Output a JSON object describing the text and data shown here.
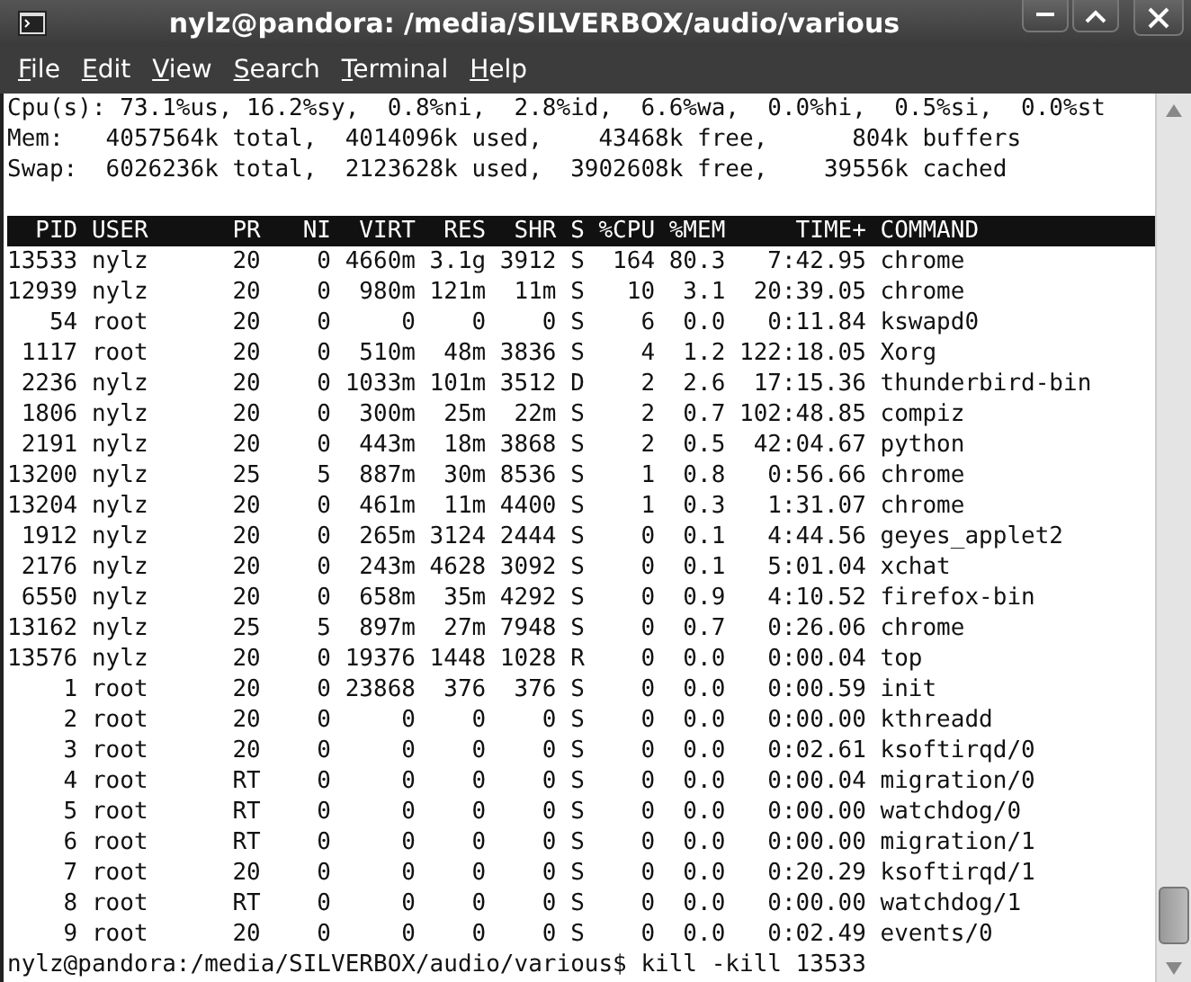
{
  "window": {
    "title": "nylz@pandora: /media/SILVERBOX/audio/various"
  },
  "menu": [
    "File",
    "Edit",
    "View",
    "Search",
    "Terminal",
    "Help"
  ],
  "terminal": {
    "summary": [
      "Cpu(s): 73.1%us, 16.2%sy,  0.8%ni,  2.8%id,  6.6%wa,  0.0%hi,  0.5%si,  0.0%st",
      "Mem:   4057564k total,  4014096k used,    43468k free,      804k buffers",
      "Swap:  6026236k total,  2123628k used,  3902608k free,    39556k cached"
    ],
    "columns": [
      "PID",
      "USER",
      "PR",
      "NI",
      "VIRT",
      "RES",
      "SHR",
      "S",
      "%CPU",
      "%MEM",
      "TIME+",
      "COMMAND"
    ],
    "processes": [
      {
        "pid": "13533",
        "user": "nylz",
        "pr": "20",
        "ni": "0",
        "virt": "4660m",
        "res": "3.1g",
        "shr": "3912",
        "s": "S",
        "cpu": "164",
        "mem": "80.3",
        "time": "7:42.95",
        "command": "chrome"
      },
      {
        "pid": "12939",
        "user": "nylz",
        "pr": "20",
        "ni": "0",
        "virt": "980m",
        "res": "121m",
        "shr": "11m",
        "s": "S",
        "cpu": "10",
        "mem": "3.1",
        "time": "20:39.05",
        "command": "chrome"
      },
      {
        "pid": "54",
        "user": "root",
        "pr": "20",
        "ni": "0",
        "virt": "0",
        "res": "0",
        "shr": "0",
        "s": "S",
        "cpu": "6",
        "mem": "0.0",
        "time": "0:11.84",
        "command": "kswapd0"
      },
      {
        "pid": "1117",
        "user": "root",
        "pr": "20",
        "ni": "0",
        "virt": "510m",
        "res": "48m",
        "shr": "3836",
        "s": "S",
        "cpu": "4",
        "mem": "1.2",
        "time": "122:18.05",
        "command": "Xorg"
      },
      {
        "pid": "2236",
        "user": "nylz",
        "pr": "20",
        "ni": "0",
        "virt": "1033m",
        "res": "101m",
        "shr": "3512",
        "s": "D",
        "cpu": "2",
        "mem": "2.6",
        "time": "17:15.36",
        "command": "thunderbird-bin"
      },
      {
        "pid": "1806",
        "user": "nylz",
        "pr": "20",
        "ni": "0",
        "virt": "300m",
        "res": "25m",
        "shr": "22m",
        "s": "S",
        "cpu": "2",
        "mem": "0.7",
        "time": "102:48.85",
        "command": "compiz"
      },
      {
        "pid": "2191",
        "user": "nylz",
        "pr": "20",
        "ni": "0",
        "virt": "443m",
        "res": "18m",
        "shr": "3868",
        "s": "S",
        "cpu": "2",
        "mem": "0.5",
        "time": "42:04.67",
        "command": "python"
      },
      {
        "pid": "13200",
        "user": "nylz",
        "pr": "25",
        "ni": "5",
        "virt": "887m",
        "res": "30m",
        "shr": "8536",
        "s": "S",
        "cpu": "1",
        "mem": "0.8",
        "time": "0:56.66",
        "command": "chrome"
      },
      {
        "pid": "13204",
        "user": "nylz",
        "pr": "20",
        "ni": "0",
        "virt": "461m",
        "res": "11m",
        "shr": "4400",
        "s": "S",
        "cpu": "1",
        "mem": "0.3",
        "time": "1:31.07",
        "command": "chrome"
      },
      {
        "pid": "1912",
        "user": "nylz",
        "pr": "20",
        "ni": "0",
        "virt": "265m",
        "res": "3124",
        "shr": "2444",
        "s": "S",
        "cpu": "0",
        "mem": "0.1",
        "time": "4:44.56",
        "command": "geyes_applet2"
      },
      {
        "pid": "2176",
        "user": "nylz",
        "pr": "20",
        "ni": "0",
        "virt": "243m",
        "res": "4628",
        "shr": "3092",
        "s": "S",
        "cpu": "0",
        "mem": "0.1",
        "time": "5:01.04",
        "command": "xchat"
      },
      {
        "pid": "6550",
        "user": "nylz",
        "pr": "20",
        "ni": "0",
        "virt": "658m",
        "res": "35m",
        "shr": "4292",
        "s": "S",
        "cpu": "0",
        "mem": "0.9",
        "time": "4:10.52",
        "command": "firefox-bin"
      },
      {
        "pid": "13162",
        "user": "nylz",
        "pr": "25",
        "ni": "5",
        "virt": "897m",
        "res": "27m",
        "shr": "7948",
        "s": "S",
        "cpu": "0",
        "mem": "0.7",
        "time": "0:26.06",
        "command": "chrome"
      },
      {
        "pid": "13576",
        "user": "nylz",
        "pr": "20",
        "ni": "0",
        "virt": "19376",
        "res": "1448",
        "shr": "1028",
        "s": "R",
        "cpu": "0",
        "mem": "0.0",
        "time": "0:00.04",
        "command": "top"
      },
      {
        "pid": "1",
        "user": "root",
        "pr": "20",
        "ni": "0",
        "virt": "23868",
        "res": "376",
        "shr": "376",
        "s": "S",
        "cpu": "0",
        "mem": "0.0",
        "time": "0:00.59",
        "command": "init"
      },
      {
        "pid": "2",
        "user": "root",
        "pr": "20",
        "ni": "0",
        "virt": "0",
        "res": "0",
        "shr": "0",
        "s": "S",
        "cpu": "0",
        "mem": "0.0",
        "time": "0:00.00",
        "command": "kthreadd"
      },
      {
        "pid": "3",
        "user": "root",
        "pr": "20",
        "ni": "0",
        "virt": "0",
        "res": "0",
        "shr": "0",
        "s": "S",
        "cpu": "0",
        "mem": "0.0",
        "time": "0:02.61",
        "command": "ksoftirqd/0"
      },
      {
        "pid": "4",
        "user": "root",
        "pr": "RT",
        "ni": "0",
        "virt": "0",
        "res": "0",
        "shr": "0",
        "s": "S",
        "cpu": "0",
        "mem": "0.0",
        "time": "0:00.04",
        "command": "migration/0"
      },
      {
        "pid": "5",
        "user": "root",
        "pr": "RT",
        "ni": "0",
        "virt": "0",
        "res": "0",
        "shr": "0",
        "s": "S",
        "cpu": "0",
        "mem": "0.0",
        "time": "0:00.00",
        "command": "watchdog/0"
      },
      {
        "pid": "6",
        "user": "root",
        "pr": "RT",
        "ni": "0",
        "virt": "0",
        "res": "0",
        "shr": "0",
        "s": "S",
        "cpu": "0",
        "mem": "0.0",
        "time": "0:00.00",
        "command": "migration/1"
      },
      {
        "pid": "7",
        "user": "root",
        "pr": "20",
        "ni": "0",
        "virt": "0",
        "res": "0",
        "shr": "0",
        "s": "S",
        "cpu": "0",
        "mem": "0.0",
        "time": "0:20.29",
        "command": "ksoftirqd/1"
      },
      {
        "pid": "8",
        "user": "root",
        "pr": "RT",
        "ni": "0",
        "virt": "0",
        "res": "0",
        "shr": "0",
        "s": "S",
        "cpu": "0",
        "mem": "0.0",
        "time": "0:00.00",
        "command": "watchdog/1"
      },
      {
        "pid": "9",
        "user": "root",
        "pr": "20",
        "ni": "0",
        "virt": "0",
        "res": "0",
        "shr": "0",
        "s": "S",
        "cpu": "0",
        "mem": "0.0",
        "time": "0:02.49",
        "command": "events/0"
      }
    ],
    "prompt": "nylz@pandora:/media/SILVERBOX/audio/various$ kill -kill 13533"
  }
}
